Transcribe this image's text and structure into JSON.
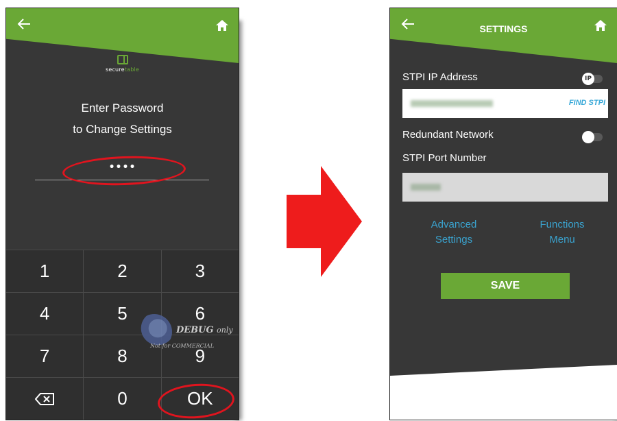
{
  "left_screen": {
    "logo": {
      "prefix": "secure",
      "suffix": "table"
    },
    "prompt_line1": "Enter Password",
    "prompt_line2": "to Change Settings",
    "password_value": "••••",
    "keypad": {
      "rows": [
        [
          "1",
          "2",
          "3"
        ],
        [
          "4",
          "5",
          "6"
        ],
        [
          "7",
          "8",
          "9"
        ],
        [
          "backspace",
          "0",
          "OK"
        ]
      ]
    },
    "watermark": {
      "title": "DEBUG",
      "title_suffix": "only",
      "subtitle": "Not for COMMERCIAL"
    }
  },
  "right_screen": {
    "title": "SETTINGS",
    "ip_label": "STPI IP Address",
    "ip_toggle_text": "IP",
    "find_button": "FIND STPI",
    "redundant_label": "Redundant Network",
    "port_label": "STPI Port Number",
    "advanced_line1": "Advanced",
    "advanced_line2": "Settings",
    "functions_line1": "Functions",
    "functions_line2": "Menu",
    "save_button": "SAVE"
  },
  "colors": {
    "accent_green": "#6aa836",
    "screen_bg": "#373737",
    "link_blue": "#3aa3cf",
    "highlight_red": "#e0141e",
    "arrow_red": "#ee1c1c"
  }
}
